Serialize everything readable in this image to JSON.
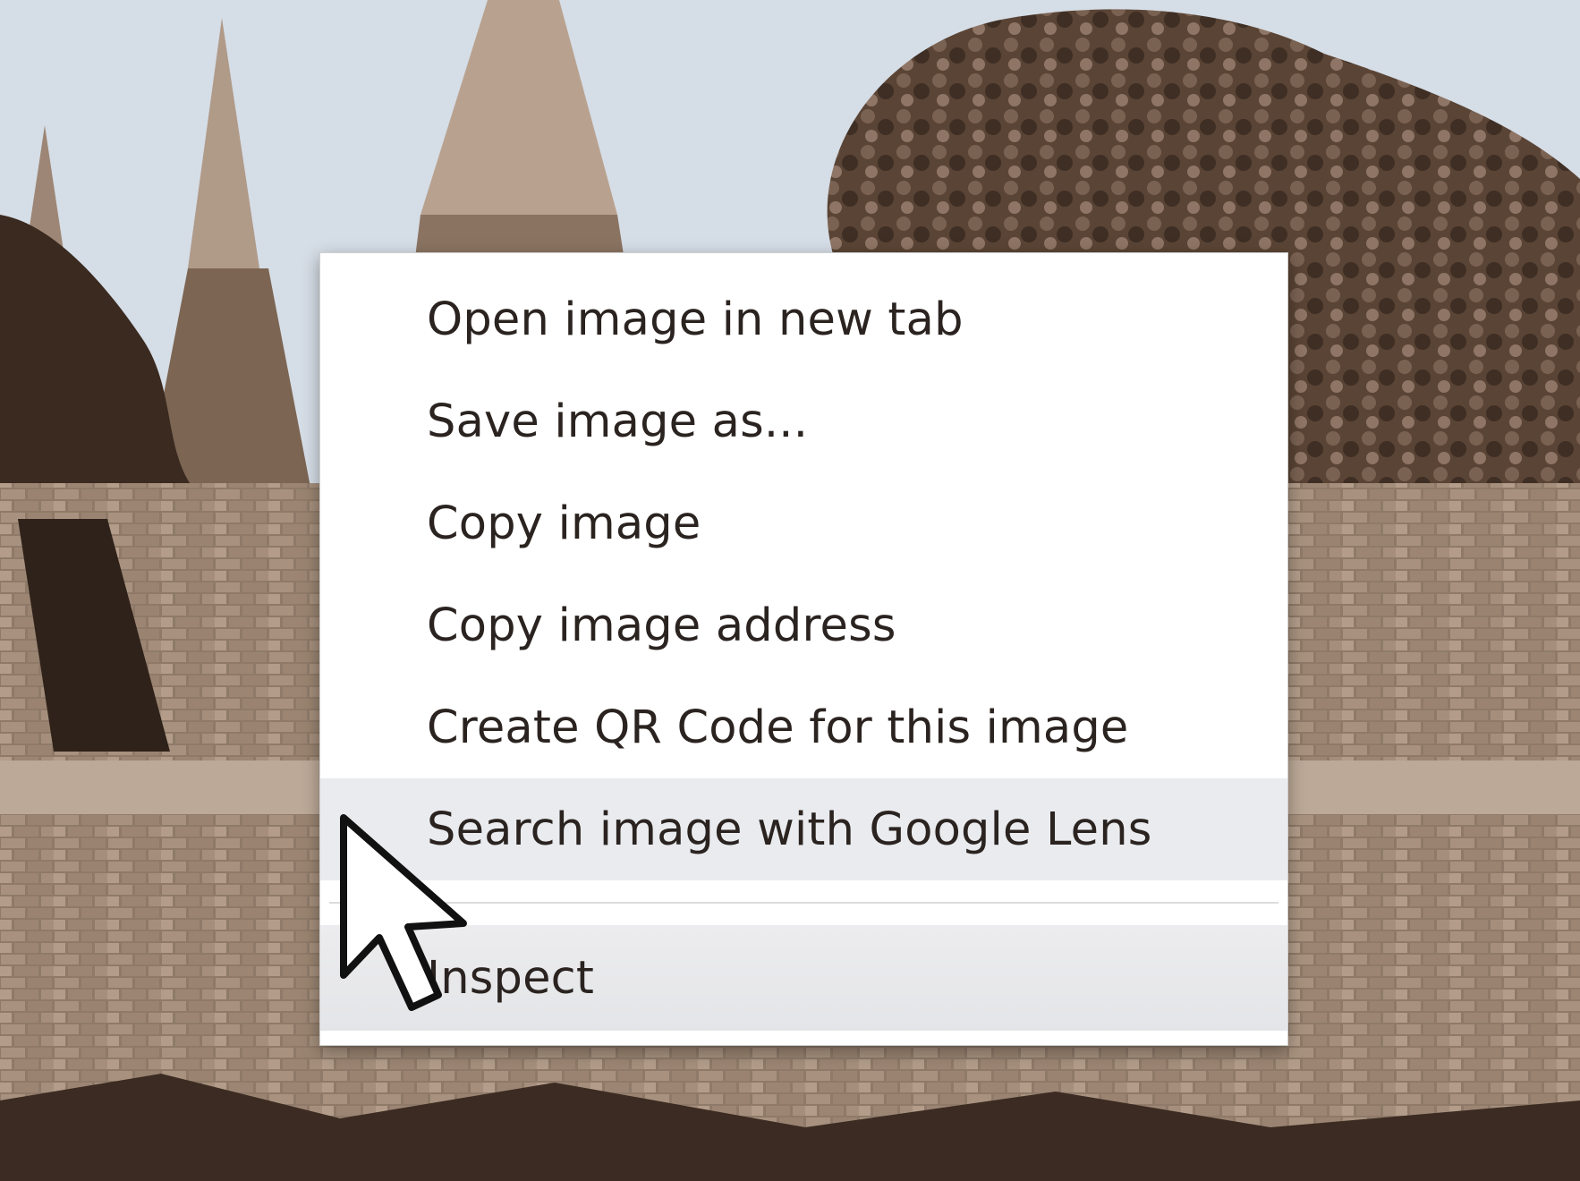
{
  "context_menu": {
    "items": [
      {
        "label": "Open image in new tab"
      },
      {
        "label": "Save image as..."
      },
      {
        "label": "Copy image"
      },
      {
        "label": "Copy image address"
      },
      {
        "label": "Create QR Code for this image"
      },
      {
        "label": "Search image with Google Lens",
        "state": "hovered"
      },
      {
        "label": "Inspect"
      }
    ]
  },
  "colors": {
    "menu_background": "#ffffff",
    "hover_background": "#e9ebee",
    "text": "#2a2320",
    "sky": "#d5dde6",
    "sepia_dark": "#3a2a20",
    "sepia_mid": "#8a7565",
    "sepia_light": "#c9b8a6"
  },
  "icons": {
    "cursor": "arrow-pointer-icon"
  }
}
